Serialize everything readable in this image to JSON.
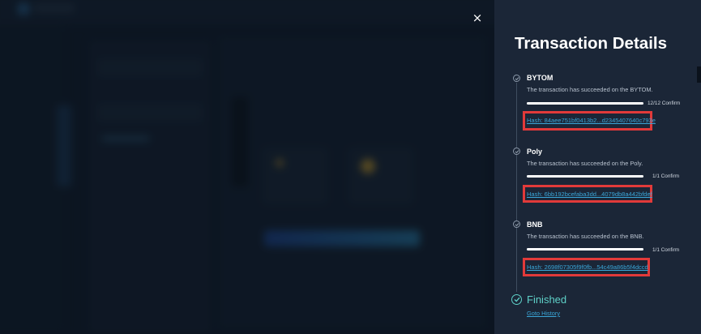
{
  "drawer": {
    "title": "Transaction Details",
    "close_symbol": "×",
    "steps": [
      {
        "name": "BYTOM",
        "description": "The transaction has succeeded on the BYTOM.",
        "progress": 1.0,
        "confirm_label": "12/12 Confirm",
        "hash": "Hash: 84aee751bf0413b2...d2345407640c793e"
      },
      {
        "name": "Poly",
        "description": "The transaction has succeeded on the Poly.",
        "progress": 1.0,
        "confirm_label": "1/1 Confirm",
        "hash": "Hash: 6bb192bcefaba3dd...4079db8a442bfdef"
      },
      {
        "name": "BNB",
        "description": "The transaction has succeeded on the BNB.",
        "progress": 1.0,
        "confirm_label": "1/1 Confirm",
        "hash": "Hash: 2698f07305f9f0fb...54c49a86b5f4dccd"
      }
    ],
    "finished_label": "Finished",
    "history_link": "Goto History"
  },
  "colors": {
    "drawer_bg": "#1b2637",
    "accent_teal": "#5fd1c8",
    "link_blue": "#3aa6d8",
    "highlight_red": "#e23a3a"
  },
  "icons": {
    "close": "close-icon",
    "step_status": "check-circle-icon",
    "finished_status": "check-circle-icon"
  }
}
